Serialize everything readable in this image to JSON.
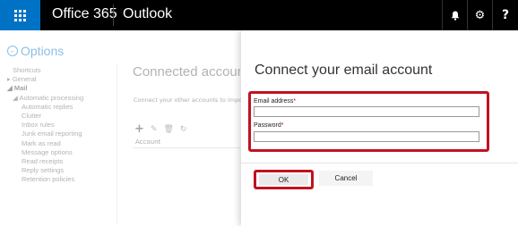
{
  "topbar": {
    "waffle_icon": "app-launcher-icon",
    "brand": "Office 365",
    "app_name": "Outlook",
    "bell_glyph": "🔔",
    "gear_glyph": "⚙",
    "help_glyph": "?"
  },
  "options": {
    "title": "Options",
    "nav": [
      {
        "label": "Shortcuts",
        "level": 0
      },
      {
        "label": "General",
        "level": 1,
        "prefix": "▸ "
      },
      {
        "label": "Mail",
        "level": 1,
        "prefix": "◢ ",
        "bold": true
      },
      {
        "label": "Automatic processing",
        "level": 2,
        "prefix": "◢ "
      },
      {
        "label": "Automatic replies",
        "level": 3
      },
      {
        "label": "Clutter",
        "level": 3
      },
      {
        "label": "Inbox rules",
        "level": 3
      },
      {
        "label": "Junk email reporting",
        "level": 3
      },
      {
        "label": "Mark as read",
        "level": 3
      },
      {
        "label": "Message options",
        "level": 3
      },
      {
        "label": "Read receipts",
        "level": 3
      },
      {
        "label": "Reply settings",
        "level": 3
      },
      {
        "label": "Retention policies",
        "level": 3
      }
    ]
  },
  "connected_accounts": {
    "title": "Connected accounts",
    "description": "Connect your other accounts to import",
    "column_header": "Account"
  },
  "dialog": {
    "title": "Connect your email account",
    "email_label": "Email address",
    "email_value": "",
    "password_label": "Password",
    "password_value": "",
    "required_mark": "*",
    "ok_label": "OK",
    "cancel_label": "Cancel"
  },
  "colors": {
    "accent": "#0072c6",
    "highlight": "#c1121f",
    "topbar": "#000000"
  }
}
